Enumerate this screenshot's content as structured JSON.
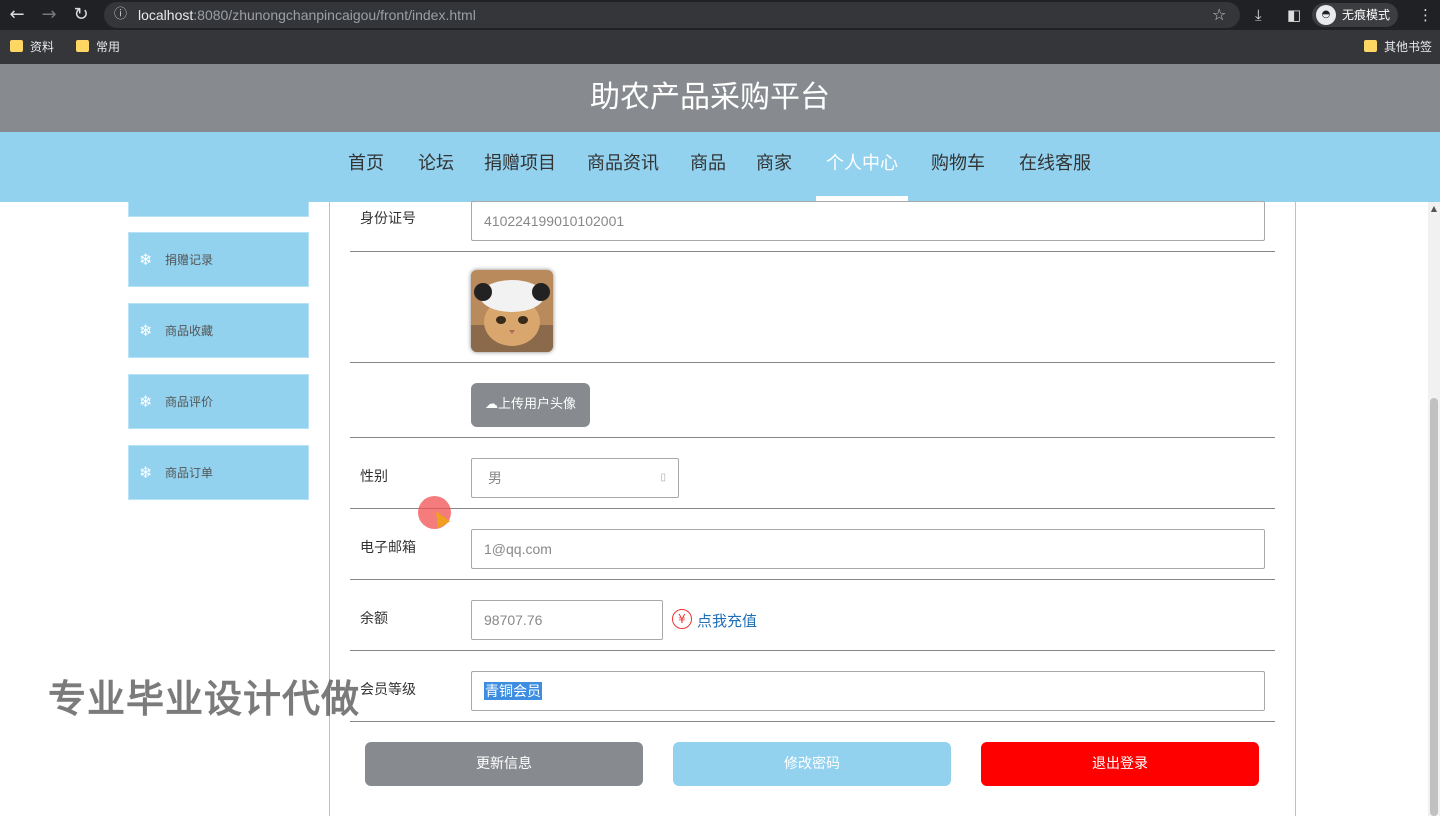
{
  "browser": {
    "url_host": "localhost",
    "url_rest": ":8080/zhunongchanpincaigou/front/index.html",
    "incognito_label": "无痕模式",
    "bookmarks": [
      "资料",
      "常用"
    ],
    "other_bookmarks": "其他书签"
  },
  "site": {
    "title": "助农产品采购平台",
    "nav": [
      "首页",
      "论坛",
      "捐赠项目",
      "商品资讯",
      "商品",
      "商家",
      "个人中心",
      "购物车",
      "在线客服"
    ],
    "active_nav": "个人中心"
  },
  "sidebar": {
    "items": [
      "捐赠记录",
      "商品收藏",
      "商品评价",
      "商品订单"
    ]
  },
  "form": {
    "id_label": "身份证号",
    "id_value": "410224199010102001",
    "upload_label": "上传用户头像",
    "gender_label": "性别",
    "gender_value": "男",
    "email_label": "电子邮箱",
    "email_value": "1@qq.com",
    "balance_label": "余额",
    "balance_value": "98707.76",
    "recharge_label": "点我充值",
    "level_label": "会员等级",
    "level_value": "青铜会员"
  },
  "actions": {
    "update": "更新信息",
    "password": "修改密码",
    "logout": "退出登录"
  },
  "watermark": "专业毕业设计代做",
  "colors": {
    "header_gray": "#878a8f",
    "nav_blue": "#92d2ef",
    "logout_red": "#ff0000",
    "link_blue": "#1e6fb8"
  }
}
